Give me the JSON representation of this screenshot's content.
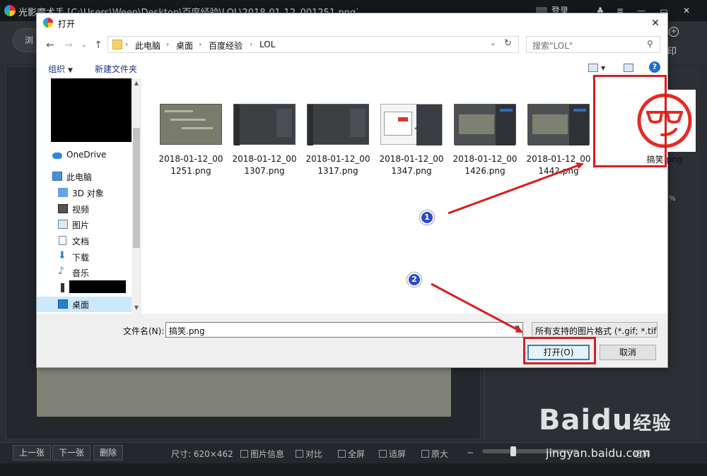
{
  "app": {
    "title": "光影魔术手 [C:\\Users\\Ween\\Desktop\\百度经验\\LOL\\2018-01-12_001251.png]",
    "login_label": "登录",
    "left_tool_label": "浏",
    "right_tool_label": "印",
    "zoom_percent": "%",
    "bottom": {
      "prev_label": "上一张",
      "next_label": "下一张",
      "delete_label": "删除",
      "size_label": "尺寸: 620×462",
      "info_label": "图片信息",
      "compare_label": "对比",
      "fullscreen_label": "全屏",
      "fit_label": "适屏",
      "original_label": "原大",
      "fit_window_label": "适屏"
    }
  },
  "dialog": {
    "title": "打开",
    "close_glyph": "✕",
    "breadcrumb": [
      "此电脑",
      "桌面",
      "百度经验",
      "LOL"
    ],
    "search_placeholder": "搜索\"LOL\"",
    "organize_label": "组织",
    "new_folder_label": "新建文件夹",
    "help_glyph": "?",
    "nav_items": [
      {
        "label": "OneDrive",
        "icon": "cloud-icon"
      },
      {
        "label": "此电脑",
        "icon": "computer-icon"
      },
      {
        "label": "3D 对象",
        "icon": "cube-icon"
      },
      {
        "label": "视频",
        "icon": "video-icon"
      },
      {
        "label": "图片",
        "icon": "picture-icon"
      },
      {
        "label": "文档",
        "icon": "document-icon"
      },
      {
        "label": "下载",
        "icon": "download-icon"
      },
      {
        "label": "音乐",
        "icon": "music-icon"
      },
      {
        "label": "",
        "icon": "drive-icon"
      },
      {
        "label": "桌面",
        "icon": "desktop-icon"
      }
    ],
    "files": [
      {
        "name": "2018-01-12_001251.png"
      },
      {
        "name": "2018-01-12_001307.png"
      },
      {
        "name": "2018-01-12_001317.png"
      },
      {
        "name": "2018-01-12_001347.png"
      },
      {
        "name": "2018-01-12_001426.png"
      },
      {
        "name": "2018-01-12_001442.png"
      },
      {
        "name": "搞笑.png"
      }
    ],
    "filename_label": "文件名(N):",
    "filename_value": "搞笑.png",
    "filetype_value": "所有支持的图片格式 (*.gif; *.tif",
    "open_label": "打开(O)",
    "cancel_label": "取消"
  },
  "annotations": {
    "badge_1": "1",
    "badge_2": "2",
    "color": "#d61f1f"
  },
  "watermark": {
    "logo_bai": "Bai",
    "logo_du": "du",
    "logo_cn": "经验",
    "url": "jingyan.baidu.com"
  }
}
